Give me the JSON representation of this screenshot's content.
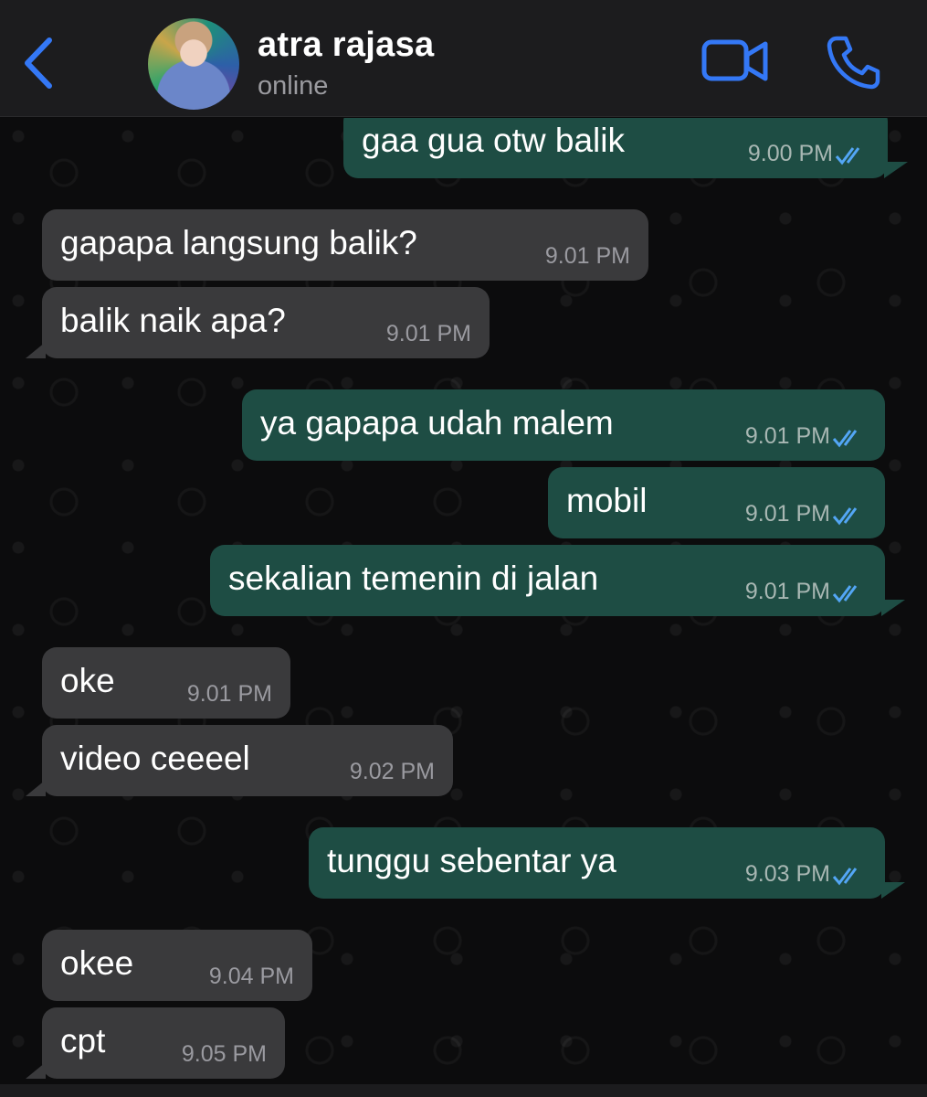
{
  "header": {
    "contact_name": "atra rajasa",
    "status": "online",
    "back_icon": "chevron-left-icon",
    "video_icon": "video-camera-icon",
    "call_icon": "phone-icon"
  },
  "colors": {
    "accent": "#3478f6",
    "incoming_bubble": "#3a3a3c",
    "outgoing_bubble": "#1e4d44",
    "read_ticks": "#53a6f5"
  },
  "messages": [
    {
      "direction": "out",
      "text": "gaa gua otw balik",
      "time": "9.00 PM",
      "read": true
    },
    {
      "direction": "in",
      "text": "gapapa langsung balik?",
      "time": "9.01 PM"
    },
    {
      "direction": "in",
      "text": "balik naik apa?",
      "time": "9.01 PM"
    },
    {
      "direction": "out",
      "text": "ya gapapa udah malem",
      "time": "9.01 PM",
      "read": true
    },
    {
      "direction": "out",
      "text": "mobil",
      "time": "9.01 PM",
      "read": true
    },
    {
      "direction": "out",
      "text": "sekalian temenin di jalan",
      "time": "9.01 PM",
      "read": true
    },
    {
      "direction": "in",
      "text": "oke",
      "time": "9.01 PM"
    },
    {
      "direction": "in",
      "text": "video ceeeel",
      "time": "9.02 PM"
    },
    {
      "direction": "out",
      "text": "tunggu sebentar ya",
      "time": "9.03 PM",
      "read": true
    },
    {
      "direction": "in",
      "text": "okee",
      "time": "9.04 PM"
    },
    {
      "direction": "in",
      "text": "cpt",
      "time": "9.05 PM"
    }
  ]
}
